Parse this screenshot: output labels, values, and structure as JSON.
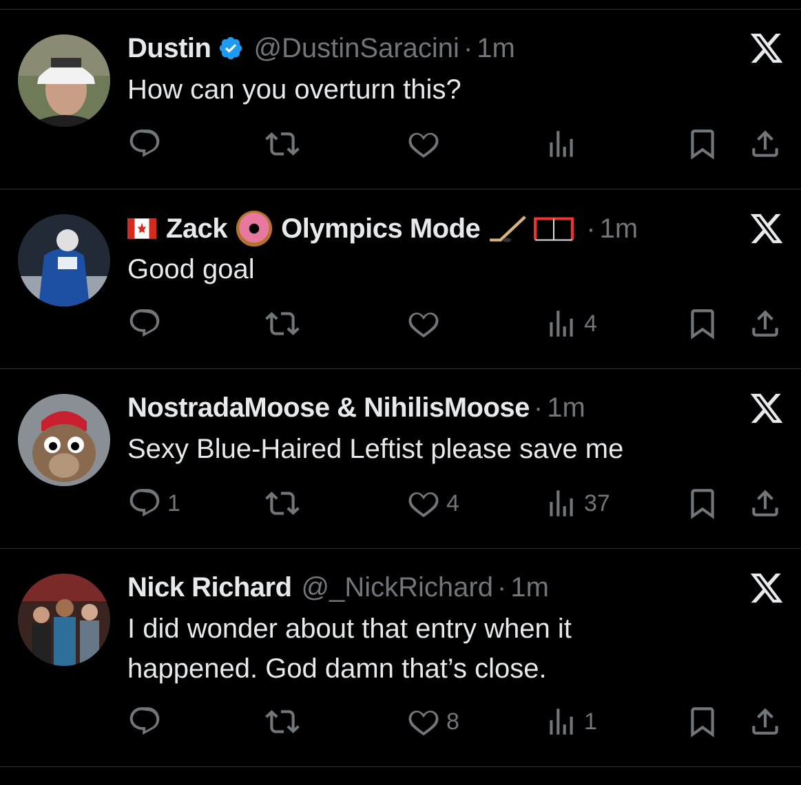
{
  "replies": [
    {
      "name": "Dustin",
      "verified": true,
      "handle": "@DustinSaracini",
      "separator": "·",
      "time": "1m",
      "text": "How can you overturn this?",
      "counts": {
        "reply": "",
        "retweet": "",
        "like": "",
        "views": ""
      }
    },
    {
      "name_parts": [
        "Zack",
        "Olympics Mode"
      ],
      "separator": "·",
      "time": "1m",
      "text": "Good goal",
      "counts": {
        "reply": "",
        "retweet": "",
        "like": "",
        "views": "4"
      }
    },
    {
      "name": "NostradaMoose & NihilisMoose",
      "separator": "·",
      "time": "1m",
      "text": "Sexy Blue-Haired Leftist please save me",
      "counts": {
        "reply": "1",
        "retweet": "",
        "like": "4",
        "views": "37"
      }
    },
    {
      "name": "Nick Richard",
      "handle": "@_NickRichard",
      "separator": "·",
      "time": "1m",
      "text": "I did wonder about that entry when it happened. God damn that’s close.",
      "counts": {
        "reply": "",
        "retweet": "",
        "like": "8",
        "views": "1"
      }
    }
  ],
  "icons": [
    "reply-icon",
    "retweet-icon",
    "like-icon",
    "views-icon",
    "bookmark-icon",
    "share-icon",
    "x-logo-icon",
    "verified-badge-icon"
  ],
  "colors": {
    "background": "#000000",
    "text": "#e7e9ea",
    "muted": "#71767b",
    "verified": "#1d9bf0",
    "divider": "#2f3336"
  }
}
